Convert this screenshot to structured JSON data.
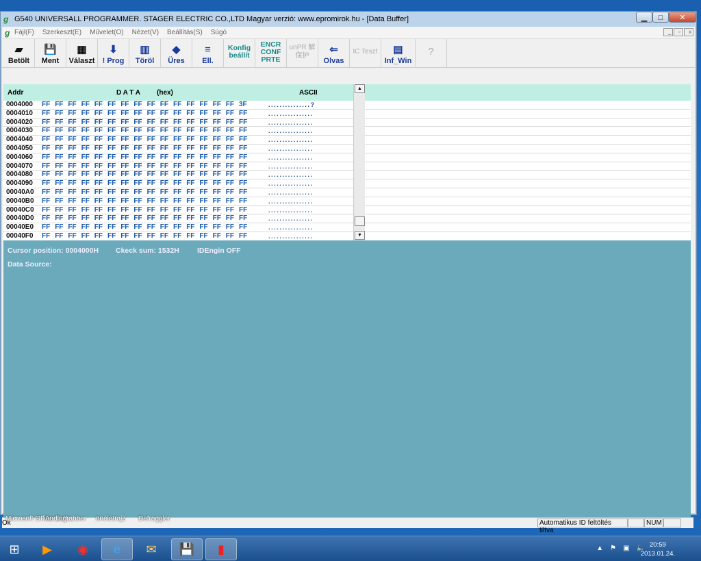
{
  "window": {
    "title": "G540 UNIVERSALL PROGRAMMER.  STAGER ELECTRIC CO.,LTD  Magyar verzió: www.epromirok.hu - [Data Buffer]"
  },
  "menu": [
    "Fájl(F)",
    "Szerkeszt(E)",
    "Művelet(O)",
    "Nézet(V)",
    "Beállítás(S)",
    "Súgó"
  ],
  "toolbar": [
    {
      "label": "Betölt",
      "icon": "folder-open-icon",
      "sym": "▰",
      "style": ""
    },
    {
      "label": "Ment",
      "icon": "floppy-disk-icon",
      "sym": "💾",
      "style": ""
    },
    {
      "label": "Választ",
      "icon": "chip-select-icon",
      "sym": "▦",
      "style": ""
    },
    {
      "label": "! Prog",
      "icon": "program-icon",
      "sym": "⬇",
      "style": "blue"
    },
    {
      "label": "Töröl",
      "icon": "erase-icon",
      "sym": "▥",
      "style": "blue"
    },
    {
      "label": "Üres",
      "icon": "blank-check-icon",
      "sym": "◆",
      "style": "blue"
    },
    {
      "label": "Ell.",
      "icon": "verify-icon",
      "sym": "≡",
      "style": "blue"
    },
    {
      "label": "Konfig beállít",
      "icon": "",
      "sym": "",
      "style": "teal"
    },
    {
      "label": "ENCR CONF PRTE",
      "icon": "",
      "sym": "",
      "style": "teal"
    },
    {
      "label": "unPR 解保护",
      "icon": "",
      "sym": "",
      "style": "gray"
    },
    {
      "label": "Olvas",
      "icon": "read-icon",
      "sym": "⇐",
      "style": "blue"
    },
    {
      "label": "IC Teszt",
      "icon": "",
      "sym": "",
      "style": "gray"
    },
    {
      "label": "Inf_Win",
      "icon": "info-window-icon",
      "sym": "▤",
      "style": "blue"
    },
    {
      "label": "",
      "icon": "help-icon",
      "sym": "?",
      "style": "gray"
    }
  ],
  "grid": {
    "headers": {
      "addr": "Addr",
      "data": "D A T A",
      "hex": "(hex)",
      "ascii": "ASCII"
    },
    "rows": [
      {
        "addr": "0004000",
        "bytes": [
          "FF",
          "FF",
          "FF",
          "FF",
          "FF",
          "FF",
          "FF",
          "FF",
          "FF",
          "FF",
          "FF",
          "FF",
          "FF",
          "FF",
          "FF",
          "3F"
        ],
        "ascii": "...............?"
      },
      {
        "addr": "0004010",
        "bytes": [
          "FF",
          "FF",
          "FF",
          "FF",
          "FF",
          "FF",
          "FF",
          "FF",
          "FF",
          "FF",
          "FF",
          "FF",
          "FF",
          "FF",
          "FF",
          "FF"
        ],
        "ascii": "................"
      },
      {
        "addr": "0004020",
        "bytes": [
          "FF",
          "FF",
          "FF",
          "FF",
          "FF",
          "FF",
          "FF",
          "FF",
          "FF",
          "FF",
          "FF",
          "FF",
          "FF",
          "FF",
          "FF",
          "FF"
        ],
        "ascii": "................"
      },
      {
        "addr": "0004030",
        "bytes": [
          "FF",
          "FF",
          "FF",
          "FF",
          "FF",
          "FF",
          "FF",
          "FF",
          "FF",
          "FF",
          "FF",
          "FF",
          "FF",
          "FF",
          "FF",
          "FF"
        ],
        "ascii": "................"
      },
      {
        "addr": "0004040",
        "bytes": [
          "FF",
          "FF",
          "FF",
          "FF",
          "FF",
          "FF",
          "FF",
          "FF",
          "FF",
          "FF",
          "FF",
          "FF",
          "FF",
          "FF",
          "FF",
          "FF"
        ],
        "ascii": "................"
      },
      {
        "addr": "0004050",
        "bytes": [
          "FF",
          "FF",
          "FF",
          "FF",
          "FF",
          "FF",
          "FF",
          "FF",
          "FF",
          "FF",
          "FF",
          "FF",
          "FF",
          "FF",
          "FF",
          "FF"
        ],
        "ascii": "................"
      },
      {
        "addr": "0004060",
        "bytes": [
          "FF",
          "FF",
          "FF",
          "FF",
          "FF",
          "FF",
          "FF",
          "FF",
          "FF",
          "FF",
          "FF",
          "FF",
          "FF",
          "FF",
          "FF",
          "FF"
        ],
        "ascii": "................"
      },
      {
        "addr": "0004070",
        "bytes": [
          "FF",
          "FF",
          "FF",
          "FF",
          "FF",
          "FF",
          "FF",
          "FF",
          "FF",
          "FF",
          "FF",
          "FF",
          "FF",
          "FF",
          "FF",
          "FF"
        ],
        "ascii": "................"
      },
      {
        "addr": "0004080",
        "bytes": [
          "FF",
          "FF",
          "FF",
          "FF",
          "FF",
          "FF",
          "FF",
          "FF",
          "FF",
          "FF",
          "FF",
          "FF",
          "FF",
          "FF",
          "FF",
          "FF"
        ],
        "ascii": "................"
      },
      {
        "addr": "0004090",
        "bytes": [
          "FF",
          "FF",
          "FF",
          "FF",
          "FF",
          "FF",
          "FF",
          "FF",
          "FF",
          "FF",
          "FF",
          "FF",
          "FF",
          "FF",
          "FF",
          "FF"
        ],
        "ascii": "................"
      },
      {
        "addr": "00040A0",
        "bytes": [
          "FF",
          "FF",
          "FF",
          "FF",
          "FF",
          "FF",
          "FF",
          "FF",
          "FF",
          "FF",
          "FF",
          "FF",
          "FF",
          "FF",
          "FF",
          "FF"
        ],
        "ascii": "................"
      },
      {
        "addr": "00040B0",
        "bytes": [
          "FF",
          "FF",
          "FF",
          "FF",
          "FF",
          "FF",
          "FF",
          "FF",
          "FF",
          "FF",
          "FF",
          "FF",
          "FF",
          "FF",
          "FF",
          "FF"
        ],
        "ascii": "................"
      },
      {
        "addr": "00040C0",
        "bytes": [
          "FF",
          "FF",
          "FF",
          "FF",
          "FF",
          "FF",
          "FF",
          "FF",
          "FF",
          "FF",
          "FF",
          "FF",
          "FF",
          "FF",
          "FF",
          "FF"
        ],
        "ascii": "................"
      },
      {
        "addr": "00040D0",
        "bytes": [
          "FF",
          "FF",
          "FF",
          "FF",
          "FF",
          "FF",
          "FF",
          "FF",
          "FF",
          "FF",
          "FF",
          "FF",
          "FF",
          "FF",
          "FF",
          "FF"
        ],
        "ascii": "................"
      },
      {
        "addr": "00040E0",
        "bytes": [
          "FF",
          "FF",
          "FF",
          "FF",
          "FF",
          "FF",
          "FF",
          "FF",
          "FF",
          "FF",
          "FF",
          "FF",
          "FF",
          "FF",
          "FF",
          "FF"
        ],
        "ascii": "................"
      },
      {
        "addr": "00040F0",
        "bytes": [
          "FF",
          "FF",
          "FF",
          "FF",
          "FF",
          "FF",
          "FF",
          "FF",
          "FF",
          "FF",
          "FF",
          "FF",
          "FF",
          "FF",
          "FF",
          "FF"
        ],
        "ascii": "................"
      }
    ]
  },
  "info": {
    "cursor": "Cursor position:  0004000H",
    "checksum": "Ckeck sum:  1532H",
    "idengin": "IDEngin OFF",
    "source": "Data Source:"
  },
  "status": {
    "text": "Ok",
    "autoid": "Automatikus ID feltöltés tiltva",
    "num": "NUM"
  },
  "desktop": [
    "Microsoft Office Outl...",
    "Audiograbber",
    "önéletrajz",
    "Defraggler"
  ],
  "taskbar": {
    "time": "20:59",
    "date": "2013.01.24."
  },
  "colors": {
    "grid_header": "#bfeee2",
    "hex_text": "#1a5aa8",
    "info_bg": "#6aaabb"
  }
}
